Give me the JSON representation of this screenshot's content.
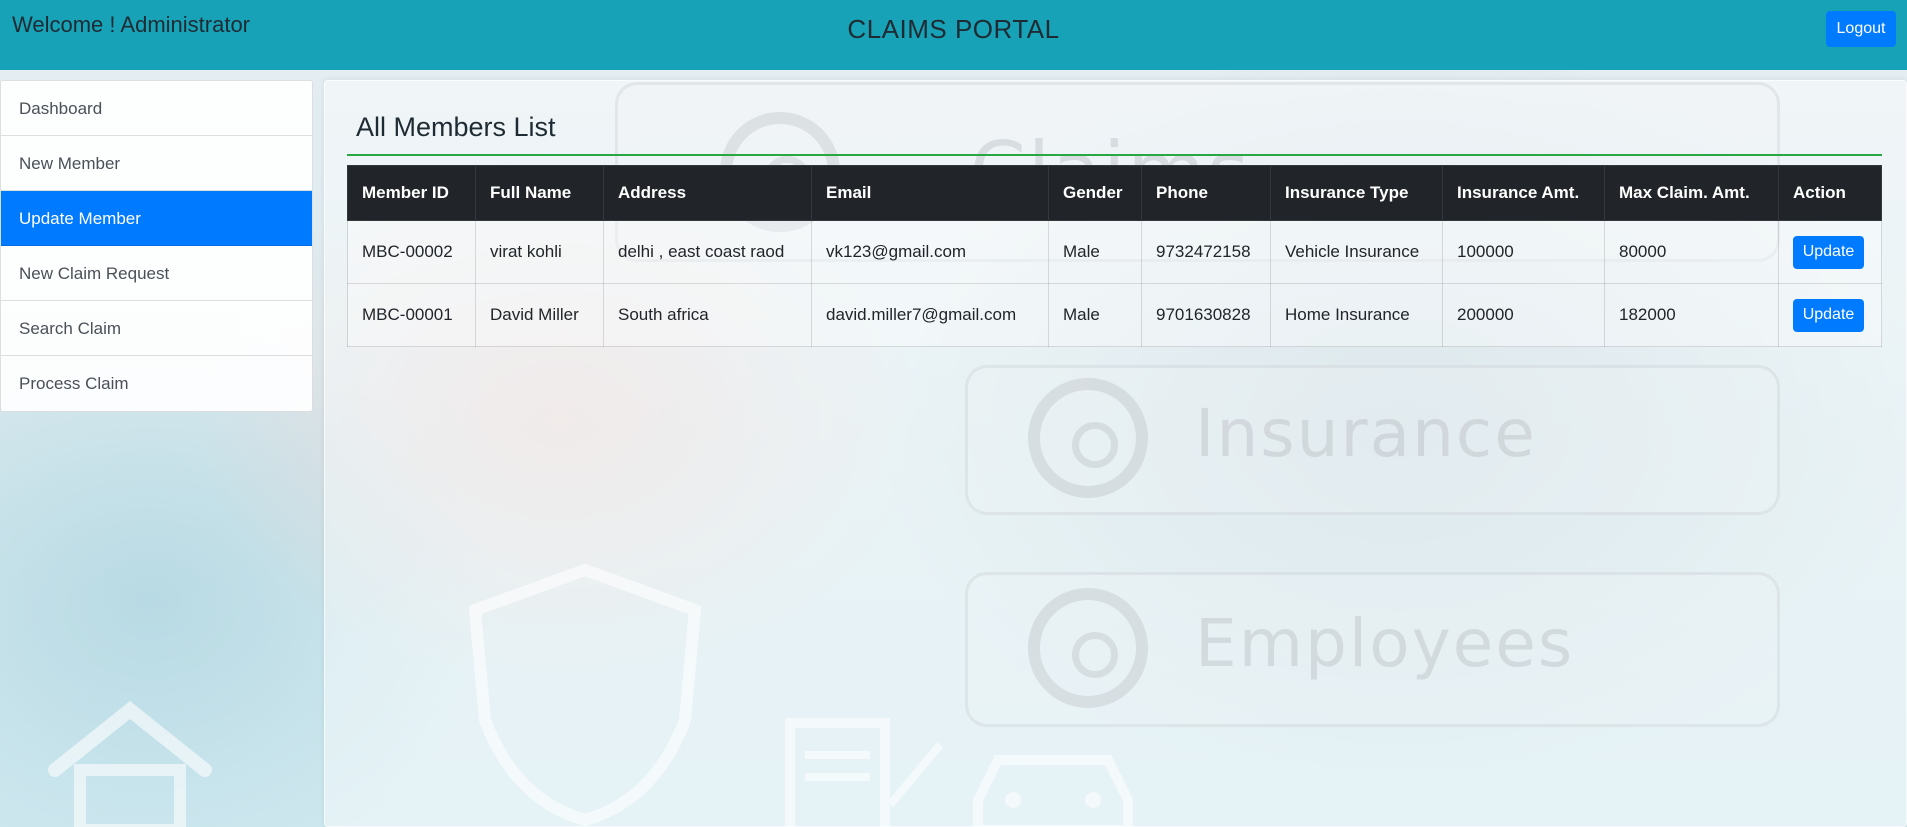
{
  "header": {
    "welcome": "Welcome ! Administrator",
    "title": "CLAIMS PORTAL",
    "logout_label": "Logout"
  },
  "background": {
    "words": [
      "Claims",
      "Insurance",
      "Employees"
    ]
  },
  "sidebar": {
    "items": [
      {
        "label": "Dashboard",
        "active": false
      },
      {
        "label": "New Member",
        "active": false
      },
      {
        "label": "Update Member",
        "active": true
      },
      {
        "label": "New Claim Request",
        "active": false
      },
      {
        "label": "Search Claim",
        "active": false
      },
      {
        "label": "Process Claim",
        "active": false
      }
    ]
  },
  "main": {
    "title": "All Members List",
    "table": {
      "columns": [
        "Member ID",
        "Full Name",
        "Address",
        "Email",
        "Gender",
        "Phone",
        "Insurance Type",
        "Insurance Amt.",
        "Max Claim. Amt.",
        "Action"
      ],
      "rows": [
        {
          "member_id": "MBC-00002",
          "full_name": "virat kohli",
          "address": "delhi , east coast raod",
          "email": "vk123@gmail.com",
          "gender": "Male",
          "phone": "9732472158",
          "insurance_type": "Vehicle Insurance",
          "insurance_amt": "100000",
          "max_claim_amt": "80000",
          "action": "Update"
        },
        {
          "member_id": "MBC-00001",
          "full_name": "David Miller",
          "address": "South africa",
          "email": "david.miller7@gmail.com",
          "gender": "Male",
          "phone": "9701630828",
          "insurance_type": "Home Insurance",
          "insurance_amt": "200000",
          "max_claim_amt": "182000",
          "action": "Update"
        }
      ]
    }
  },
  "colors": {
    "header": "#17a2b8",
    "primary": "#007bff",
    "table_head": "#212529",
    "title_rule": "#28a745"
  },
  "icons": [
    "house-icon",
    "shield-icon",
    "document-icon",
    "car-icon"
  ]
}
